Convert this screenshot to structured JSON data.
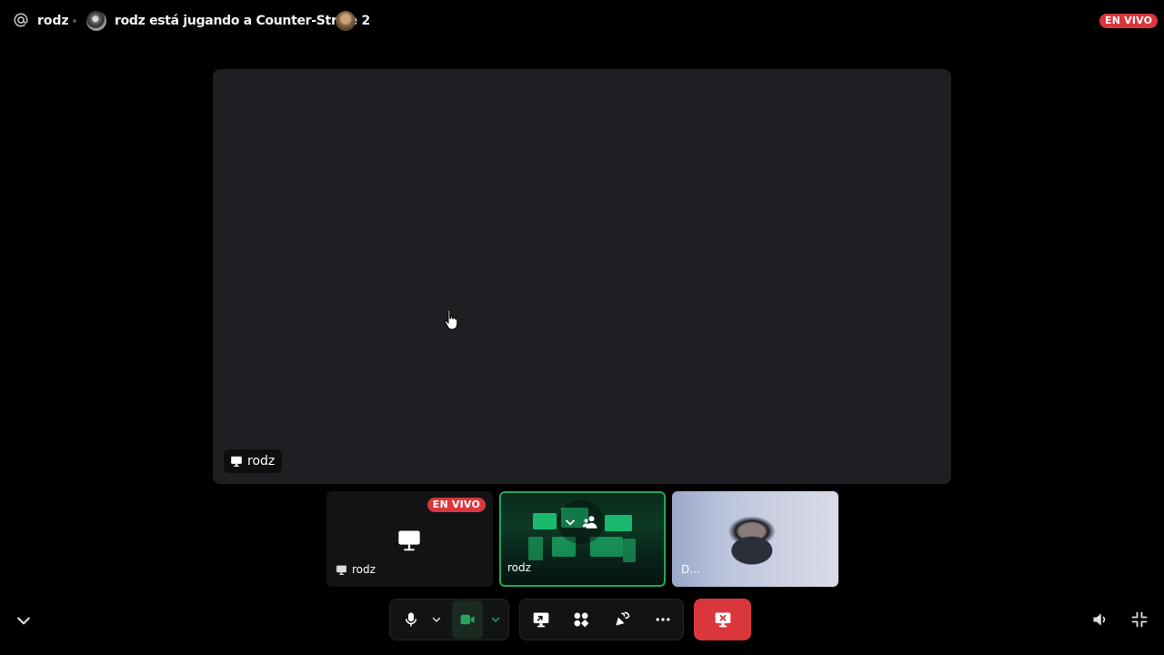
{
  "header": {
    "username": "rodz",
    "activity": "rodz está jugando a Counter-Strike 2",
    "live_badge": "EN VIVO"
  },
  "stage": {
    "label": "rodz"
  },
  "tiles": [
    {
      "name": "rodz",
      "badge": "EN VIVO",
      "kind": "stream"
    },
    {
      "name": "rodz",
      "kind": "stream-preview"
    },
    {
      "name": "D...",
      "kind": "camera"
    }
  ],
  "controls": {
    "mic": "microphone-icon",
    "camera": "camera-icon",
    "share": "screen-share-icon",
    "activities": "activities-icon",
    "soundboard": "soundboard-icon",
    "more": "more-icon",
    "leave": "leave-call-icon",
    "volume": "speaker-icon",
    "fullscreen": "exit-fullscreen-icon"
  },
  "colors": {
    "live": "#da373c",
    "speaking": "#23a55a",
    "stage_bg": "#1e1f22",
    "leave": "#da373c"
  }
}
